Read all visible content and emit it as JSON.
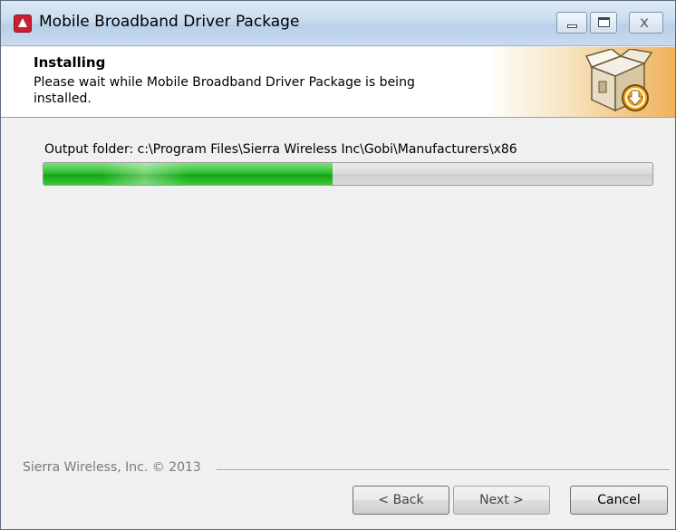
{
  "window": {
    "title": "Mobile Broadband Driver Package",
    "icon": "sierra-wireless-app-icon"
  },
  "titlebar_buttons": {
    "minimize": "minimize-icon",
    "maximize": "maximize-icon",
    "close": "close-icon",
    "close_glyph": "ⅹ"
  },
  "header": {
    "title": "Installing",
    "subtitle": "Please wait while Mobile Broadband Driver Package is being installed.",
    "icon": "install-package-box-icon"
  },
  "content": {
    "output_label": "Output folder: c:\\Program Files\\Sierra Wireless Inc\\Gobi\\Manufacturers\\x86",
    "progress_fraction": 0.475
  },
  "footer": {
    "copyright": "Sierra Wireless, Inc. © 2013"
  },
  "buttons": {
    "back": "< Back",
    "next": "Next >",
    "cancel": "Cancel"
  },
  "colors": {
    "progress_green": "#22b022",
    "header_accent": "#efb25a",
    "titlebar": "#c9dcef"
  }
}
